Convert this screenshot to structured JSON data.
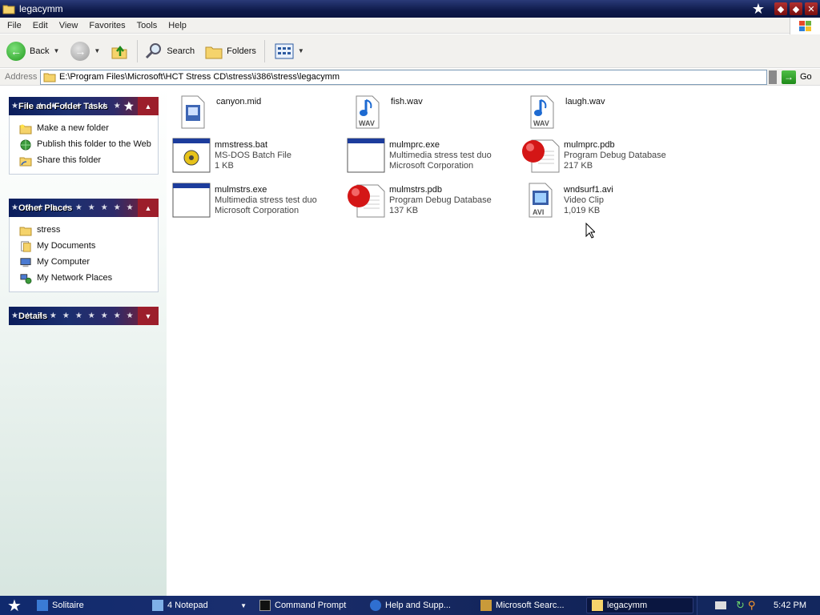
{
  "window": {
    "title": "legacymm"
  },
  "menu": [
    "File",
    "Edit",
    "View",
    "Favorites",
    "Tools",
    "Help"
  ],
  "toolbar": {
    "back_label": "Back",
    "search_label": "Search",
    "folders_label": "Folders"
  },
  "address": {
    "label": "Address",
    "path": "E:\\Program Files\\Microsoft\\HCT Stress CD\\stress\\i386\\stress\\legacymm",
    "go_label": "Go"
  },
  "panels": {
    "tasks": {
      "title": "File and Folder Tasks",
      "items": [
        "Make a new folder",
        "Publish this folder to the Web",
        "Share this folder"
      ]
    },
    "places": {
      "title": "Other Places",
      "items": [
        "stress",
        "My Documents",
        "My Computer",
        "My Network Places"
      ]
    },
    "details": {
      "title": "Details"
    }
  },
  "files": [
    {
      "name": "canyon.mid",
      "line2": "",
      "line3": "",
      "icon": "midi-icon"
    },
    {
      "name": "fish.wav",
      "line2": "",
      "line3": "",
      "icon": "wav-icon"
    },
    {
      "name": "laugh.wav",
      "line2": "",
      "line3": "",
      "icon": "wav-icon"
    },
    {
      "name": "mmstress.bat",
      "line2": "MS-DOS Batch File",
      "line3": "1 KB",
      "icon": "batch-icon"
    },
    {
      "name": "mulmprc.exe",
      "line2": "Multimedia stress test duo",
      "line3": "Microsoft Corporation",
      "icon": "exe-icon"
    },
    {
      "name": "mulmprc.pdb",
      "line2": "Program Debug Database",
      "line3": "217 KB",
      "icon": "pdb-icon"
    },
    {
      "name": "mulmstrs.exe",
      "line2": "Multimedia stress test duo",
      "line3": "Microsoft Corporation",
      "icon": "exe-icon"
    },
    {
      "name": "mulmstrs.pdb",
      "line2": "Program Debug Database",
      "line3": "137 KB",
      "icon": "pdb-icon"
    },
    {
      "name": "wndsurf1.avi",
      "line2": "Video Clip",
      "line3": "1,019 KB",
      "icon": "avi-icon"
    }
  ],
  "taskbar": {
    "tasks": [
      "Solitaire",
      "4 Notepad",
      "Command Prompt",
      "Help and Supp...",
      "Microsoft Searc...",
      "legacymm"
    ],
    "clock": "5:42 PM"
  }
}
